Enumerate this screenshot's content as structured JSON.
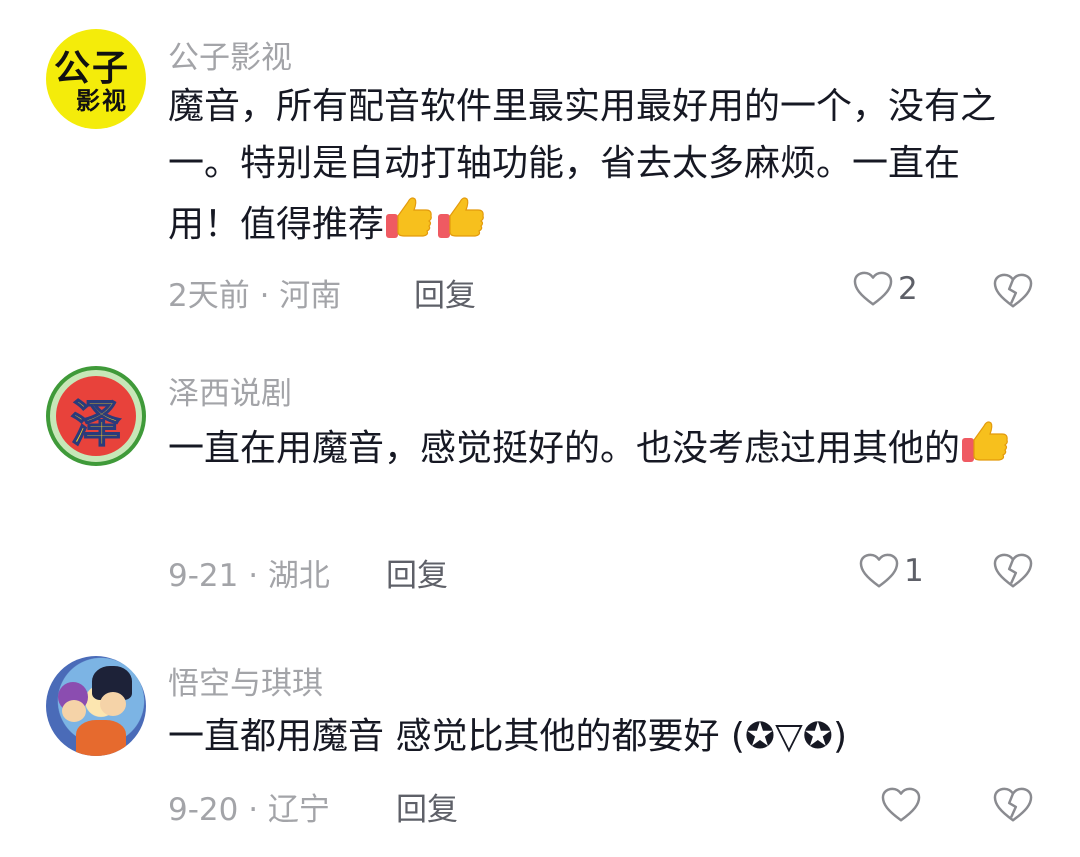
{
  "comments": [
    {
      "avatar_text_top": "公子",
      "avatar_text_bottom": "影视",
      "username": "公子影视",
      "text": "魔音，所有配音软件里最实用最好用的一个，没有之一。特别是自动打轴功能，省去太多麻烦。一直在用！值得推荐",
      "emojis": [
        "thumbs-up",
        "thumbs-up"
      ],
      "time_location": "2天前 · 河南",
      "reply_label": "回复",
      "likes": "2"
    },
    {
      "avatar_text": "泽",
      "username": "泽西说剧",
      "text": "一直在用魔音，感觉挺好的。也没考虑过用其他的",
      "emojis": [
        "thumbs-up"
      ],
      "time_location": "9-21 · 湖北",
      "reply_label": "回复",
      "likes": "1"
    },
    {
      "username": "悟空与琪琪",
      "text": "一直都用魔音 感觉比其他的都要好 (✪▽✪)",
      "emojis": [],
      "time_location": "9-20 · 辽宁",
      "reply_label": "回复",
      "likes": ""
    }
  ],
  "icons": {
    "like": "heart-outline-icon",
    "dislike": "broken-heart-icon",
    "emoji": "thumbs-up-emoji"
  },
  "colors": {
    "text": "#161823",
    "secondary": "#a3a4a8",
    "reply": "#5e6068",
    "thumb": "#f7c01d"
  }
}
